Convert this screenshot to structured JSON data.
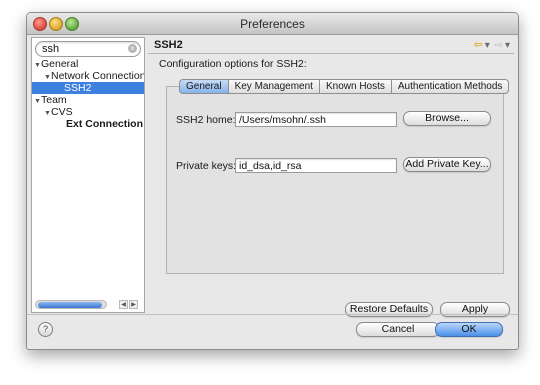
{
  "window": {
    "title": "Preferences"
  },
  "sidebar": {
    "search_value": "ssh",
    "tree": [
      {
        "label": "General",
        "level": 0,
        "expanded": true
      },
      {
        "label": "Network Connections",
        "level": 1,
        "expanded": true
      },
      {
        "label": "SSH2",
        "level": 2,
        "selected": true
      },
      {
        "label": "Team",
        "level": 0,
        "expanded": true
      },
      {
        "label": "CVS",
        "level": 1,
        "expanded": true
      },
      {
        "label": "Ext Connection M",
        "level": 2,
        "bold": true
      }
    ]
  },
  "header": {
    "page_title": "SSH2"
  },
  "content": {
    "subtitle": "Configuration options for SSH2:",
    "tabs": [
      {
        "label": "General",
        "active": true
      },
      {
        "label": "Key Management"
      },
      {
        "label": "Known Hosts"
      },
      {
        "label": "Authentication Methods"
      }
    ],
    "ssh2_home": {
      "label": "SSH2 home:",
      "value": "/Users/msohn/.ssh",
      "button": "Browse..."
    },
    "private_keys": {
      "label": "Private keys:",
      "value": "id_dsa,id_rsa",
      "button": "Add Private Key..."
    },
    "restore_defaults": "Restore Defaults",
    "apply": "Apply"
  },
  "footer": {
    "help": "?",
    "cancel": "Cancel",
    "ok": "OK"
  },
  "colors": {
    "selection": "#3d80df",
    "primary_button": "#4a90e8",
    "active_tab": "#87b2ea"
  }
}
